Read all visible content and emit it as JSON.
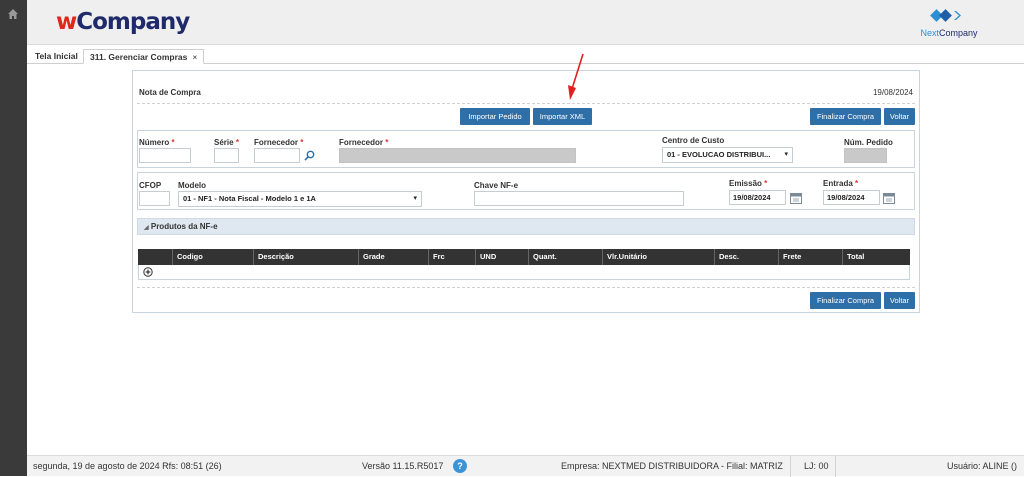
{
  "app": {
    "logo_prefix": "w",
    "logo_rest": "Company",
    "brand_right_1": "Next",
    "brand_right_2": "Company"
  },
  "tabs": [
    {
      "label": "Tela Inicial"
    },
    {
      "label": "311. Gerenciar Compras",
      "close": "×"
    }
  ],
  "form": {
    "title": "Nota de Compra",
    "date": "19/08/2024",
    "btn_import_order": "Importar Pedido",
    "btn_import_xml": "Importar XML",
    "btn_finalize": "Finalizar Compra",
    "btn_back": "Voltar",
    "req": "*",
    "fields": {
      "numero": {
        "label": "Número",
        "value": ""
      },
      "serie": {
        "label": "Série",
        "value": ""
      },
      "fornecedor": {
        "label": "Fornecedor",
        "value": ""
      },
      "fornecedor_nome": {
        "label": "Fornecedor",
        "value": ""
      },
      "centro_custo": {
        "label": "Centro de Custo",
        "value": "01 - EVOLUCAO DISTRIBUI..."
      },
      "num_pedido": {
        "label": "Núm. Pedido",
        "value": ""
      },
      "cfop": {
        "label": "CFOP",
        "value": ""
      },
      "modelo": {
        "label": "Modelo",
        "value": "01 - NF1 - Nota Fiscal - Modelo 1 e 1A"
      },
      "chave": {
        "label": "Chave NF-e",
        "value": ""
      },
      "emissao": {
        "label": "Emissão",
        "value": "19/08/2024"
      },
      "entrada": {
        "label": "Entrada",
        "value": "19/08/2024"
      }
    },
    "products_section": "Produtos da NF-e",
    "columns": [
      "Codigo",
      "Descrição",
      "Grade",
      "Frc",
      "UND",
      "Quant.",
      "Vlr.Unitário",
      "Desc.",
      "Frete",
      "Total"
    ]
  },
  "status": {
    "date_text": "segunda, 19 de agosto de 2024  Rfs: 08:51 (26)",
    "version": "Versão 11.15.R5017",
    "help": "?",
    "company": "Empresa: NEXTMED DISTRIBUIDORA - Filial: MATRIZ",
    "lj": "LJ: 00",
    "user": "Usuário: ALINE ()"
  },
  "colors": {
    "accent": "#2f6fa8",
    "arrow": "#e02020",
    "sidebar": "#3a3a3a"
  },
  "icons": [
    "home-icon",
    "search-icon",
    "calendar-icon",
    "add-circle-icon",
    "collapse-triangle-icon",
    "chevron-down-icon",
    "help-icon",
    "nextcompany-logo-icon"
  ]
}
